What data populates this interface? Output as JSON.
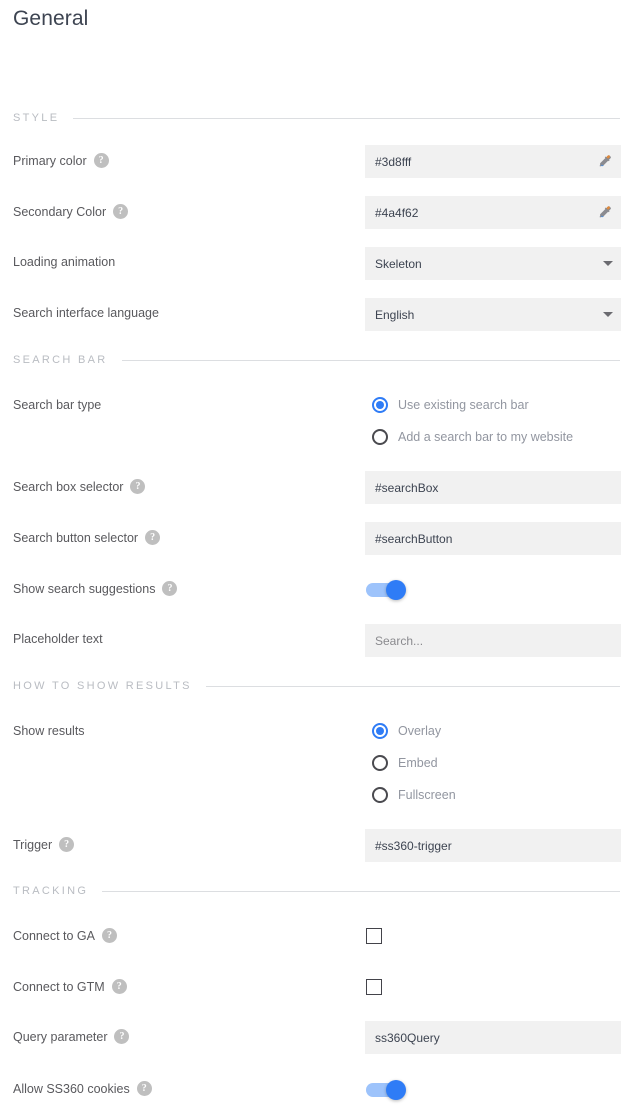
{
  "page": {
    "title": "General"
  },
  "sections": {
    "style": {
      "heading": "STYLE",
      "rows": {
        "primary_color": {
          "label": "Primary color",
          "help": "?",
          "value": "#3d8fff",
          "icon": "eyedropper-icon"
        },
        "secondary_color": {
          "label": "Secondary Color",
          "help": "?",
          "value": "#4a4f62",
          "icon": "eyedropper-icon"
        },
        "loading_animation": {
          "label": "Loading animation",
          "value": "Skeleton",
          "icon": "chevron-down-icon"
        },
        "search_interface_language": {
          "label": "Search interface language",
          "value": "English",
          "icon": "chevron-down-icon"
        }
      }
    },
    "search_bar": {
      "heading": "SEARCH BAR",
      "rows": {
        "search_bar_type": {
          "label": "Search bar type",
          "options": [
            {
              "label": "Use existing search bar",
              "checked": true
            },
            {
              "label": "Add a search bar to my website",
              "checked": false
            }
          ]
        },
        "search_box_selector": {
          "label": "Search box selector",
          "help": "?",
          "value": "#searchBox"
        },
        "search_button_selector": {
          "label": "Search button selector",
          "help": "?",
          "value": "#searchButton"
        },
        "show_search_suggestions": {
          "label": "Show search suggestions",
          "help": "?",
          "checked": true
        },
        "placeholder_text": {
          "label": "Placeholder text",
          "value": "Search..."
        }
      }
    },
    "how_to_show_results": {
      "heading": "HOW TO SHOW RESULTS",
      "rows": {
        "show_results": {
          "label": "Show results",
          "options": [
            {
              "label": "Overlay",
              "checked": true
            },
            {
              "label": "Embed",
              "checked": false
            },
            {
              "label": "Fullscreen",
              "checked": false
            }
          ]
        },
        "trigger": {
          "label": "Trigger",
          "help": "?",
          "value": "#ss360-trigger"
        }
      }
    },
    "tracking": {
      "heading": "TRACKING",
      "rows": {
        "connect_to_ga": {
          "label": "Connect to GA",
          "help": "?",
          "checked": false
        },
        "connect_to_gtm": {
          "label": "Connect to GTM",
          "help": "?",
          "checked": false
        },
        "query_parameter": {
          "label": "Query parameter",
          "help": "?",
          "value": "ss360Query"
        },
        "allow_ss360_cookies": {
          "label": "Allow SS360 cookies",
          "help": "?",
          "checked": true
        }
      }
    }
  },
  "colors": {
    "accent": "#2f7cf6",
    "field_background": "#f1f1f1",
    "label_text": "#59595d",
    "muted_text": "#9296a0",
    "heading_text": "#b9bcc2"
  }
}
